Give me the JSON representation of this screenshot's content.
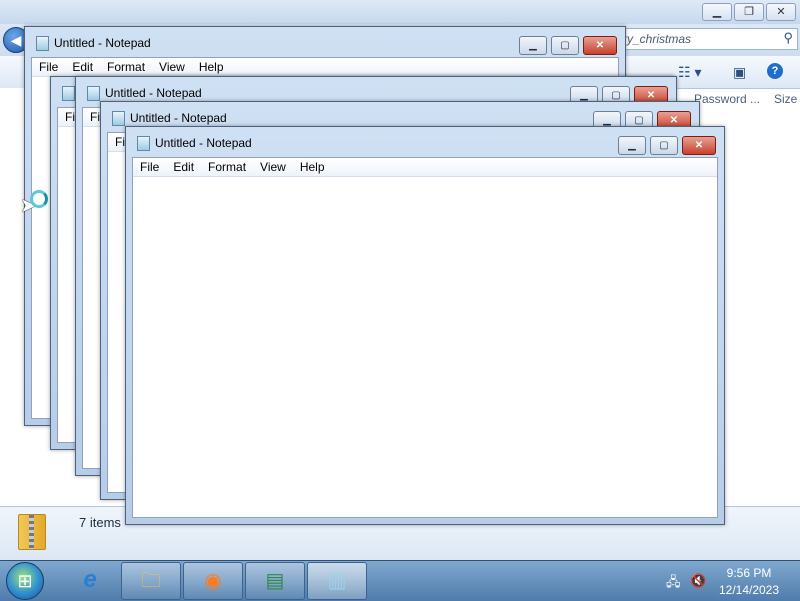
{
  "explorer": {
    "search_text": "ry_christmas",
    "column_password": "Password ...",
    "column_size": "Size",
    "items_count": "7 items"
  },
  "notepad": {
    "title": "Untitled - Notepad",
    "menu": [
      "File",
      "Edit",
      "Format",
      "View",
      "Help"
    ]
  },
  "taskbar": {
    "time": "9:56 PM",
    "date": "12/14/2023",
    "apps": [
      "explorer",
      "firefox",
      "notepad-pad",
      "notepad-active"
    ]
  },
  "icons": {
    "minimize": "minimize-icon",
    "maximize": "maximize-icon",
    "close": "close-icon",
    "search": "search-icon",
    "help": "help-icon"
  },
  "colors": {
    "title_bar": "#c6d8ee",
    "close_button": "#c7412d",
    "taskbar": "#4f7cab"
  }
}
